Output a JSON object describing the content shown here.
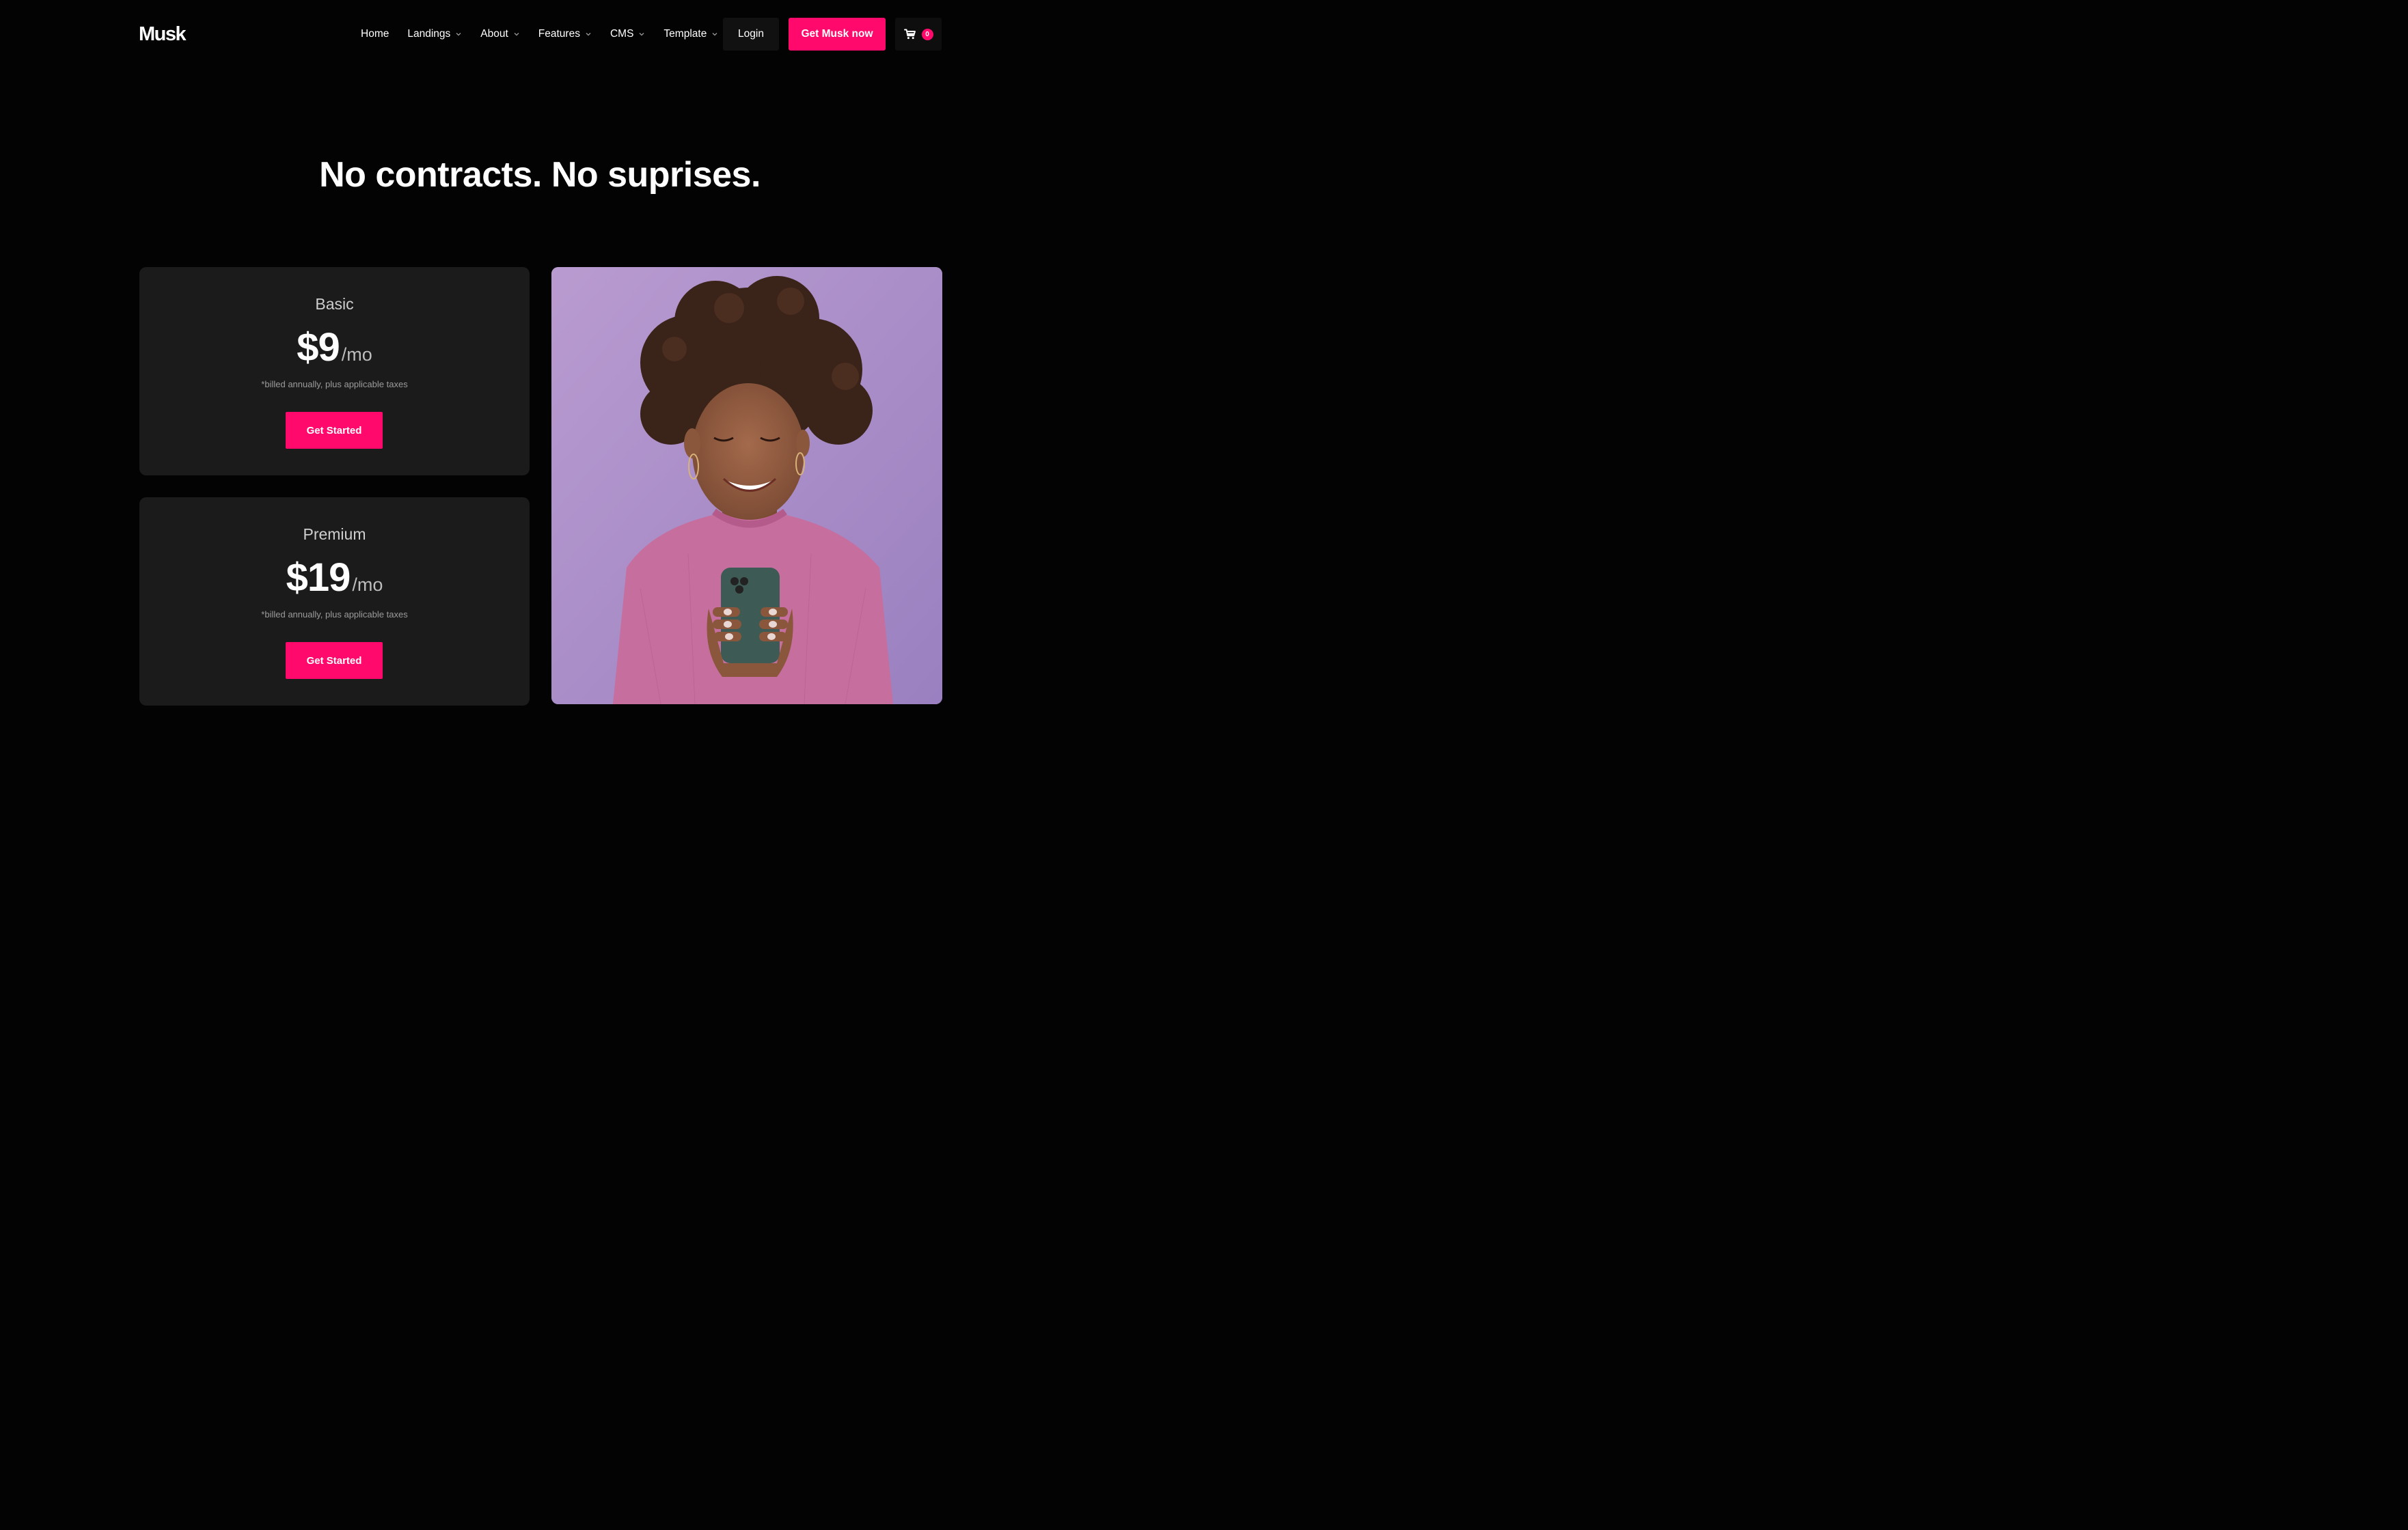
{
  "brand": {
    "name": "Musk"
  },
  "nav": {
    "items": [
      {
        "label": "Home",
        "has_dropdown": false
      },
      {
        "label": "Landings",
        "has_dropdown": true
      },
      {
        "label": "About",
        "has_dropdown": true
      },
      {
        "label": "Features",
        "has_dropdown": true
      },
      {
        "label": "CMS",
        "has_dropdown": true
      },
      {
        "label": "Template",
        "has_dropdown": true
      }
    ],
    "login_label": "Login",
    "cta_label": "Get Musk now",
    "cart_count": "0"
  },
  "hero": {
    "headline": "No contracts. No suprises."
  },
  "plans": [
    {
      "name": "Basic",
      "price": "$9",
      "period": "/mo",
      "note": "*billed annually, plus applicable taxes",
      "button": "Get Started"
    },
    {
      "name": "Premium",
      "price": "$19",
      "period": "/mo",
      "note": "*billed annually, plus applicable taxes",
      "button": "Get Started"
    }
  ],
  "colors": {
    "accent": "#ff0a6c",
    "background": "#030303",
    "card": "#1b1b1c",
    "photo_bg": "#a98dc6"
  },
  "icons": {
    "cart": "shopping-cart-icon",
    "dropdown": "chevron-down-icon"
  }
}
